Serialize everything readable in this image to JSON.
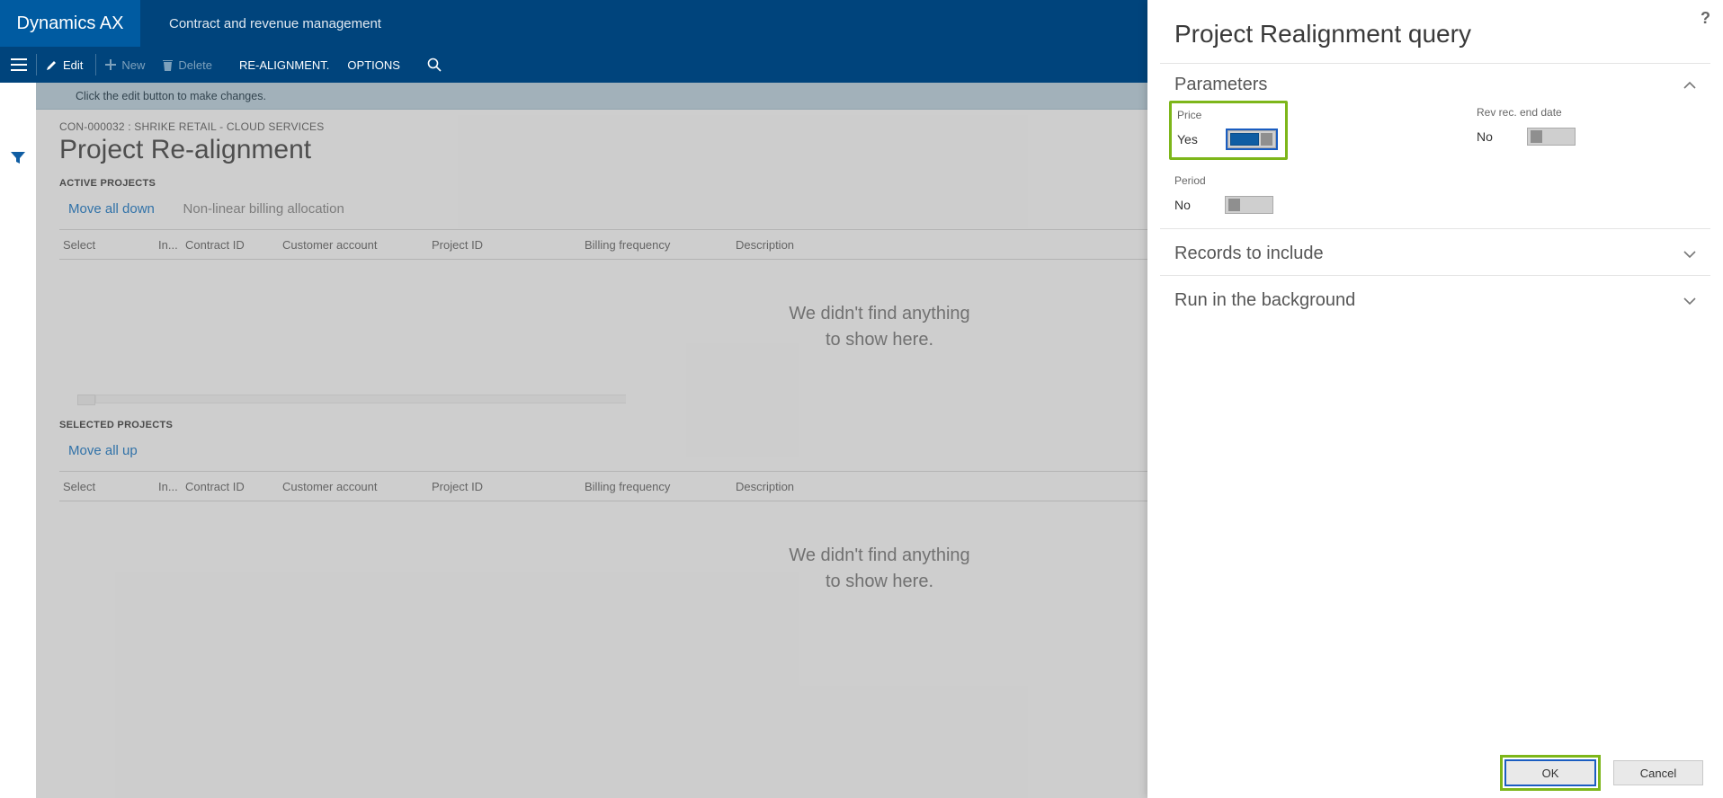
{
  "titlebar": {
    "brand": "Dynamics AX",
    "module": "Contract and revenue management"
  },
  "actionbar": {
    "edit": "Edit",
    "new": "New",
    "delete": "Delete",
    "realignment": "RE-ALIGNMENT.",
    "options": "OPTIONS"
  },
  "infobar": {
    "text": "Click the edit button to make changes."
  },
  "page": {
    "crumb": "CON-000032 : SHRIKE RETAIL - CLOUD SERVICES",
    "title": "Project Re-alignment"
  },
  "active": {
    "title": "ACTIVE PROJECTS",
    "move_down": "Move all down",
    "nonlinear": "Non-linear billing allocation",
    "cols": {
      "select": "Select",
      "in": "In...",
      "contract": "Contract ID",
      "cust": "Customer account",
      "proj": "Project ID",
      "freq": "Billing frequency",
      "desc": "Description"
    },
    "empty1": "We didn't find anything",
    "empty2": "to show here."
  },
  "selected": {
    "title": "SELECTED PROJECTS",
    "move_up": "Move all up",
    "cols": {
      "select": "Select",
      "in": "In...",
      "contract": "Contract ID",
      "cust": "Customer account",
      "proj": "Project ID",
      "freq": "Billing frequency",
      "desc": "Description"
    },
    "empty1": "We didn't find anything",
    "empty2": "to show here."
  },
  "flyout": {
    "title": "Project Realignment query",
    "parameters_title": "Parameters",
    "price_label": "Price",
    "price_value": "Yes",
    "period_label": "Period",
    "period_value": "No",
    "revrec_label": "Rev rec. end date",
    "revrec_value": "No",
    "records_title": "Records to include",
    "background_title": "Run in the background",
    "ok": "OK",
    "cancel": "Cancel"
  }
}
